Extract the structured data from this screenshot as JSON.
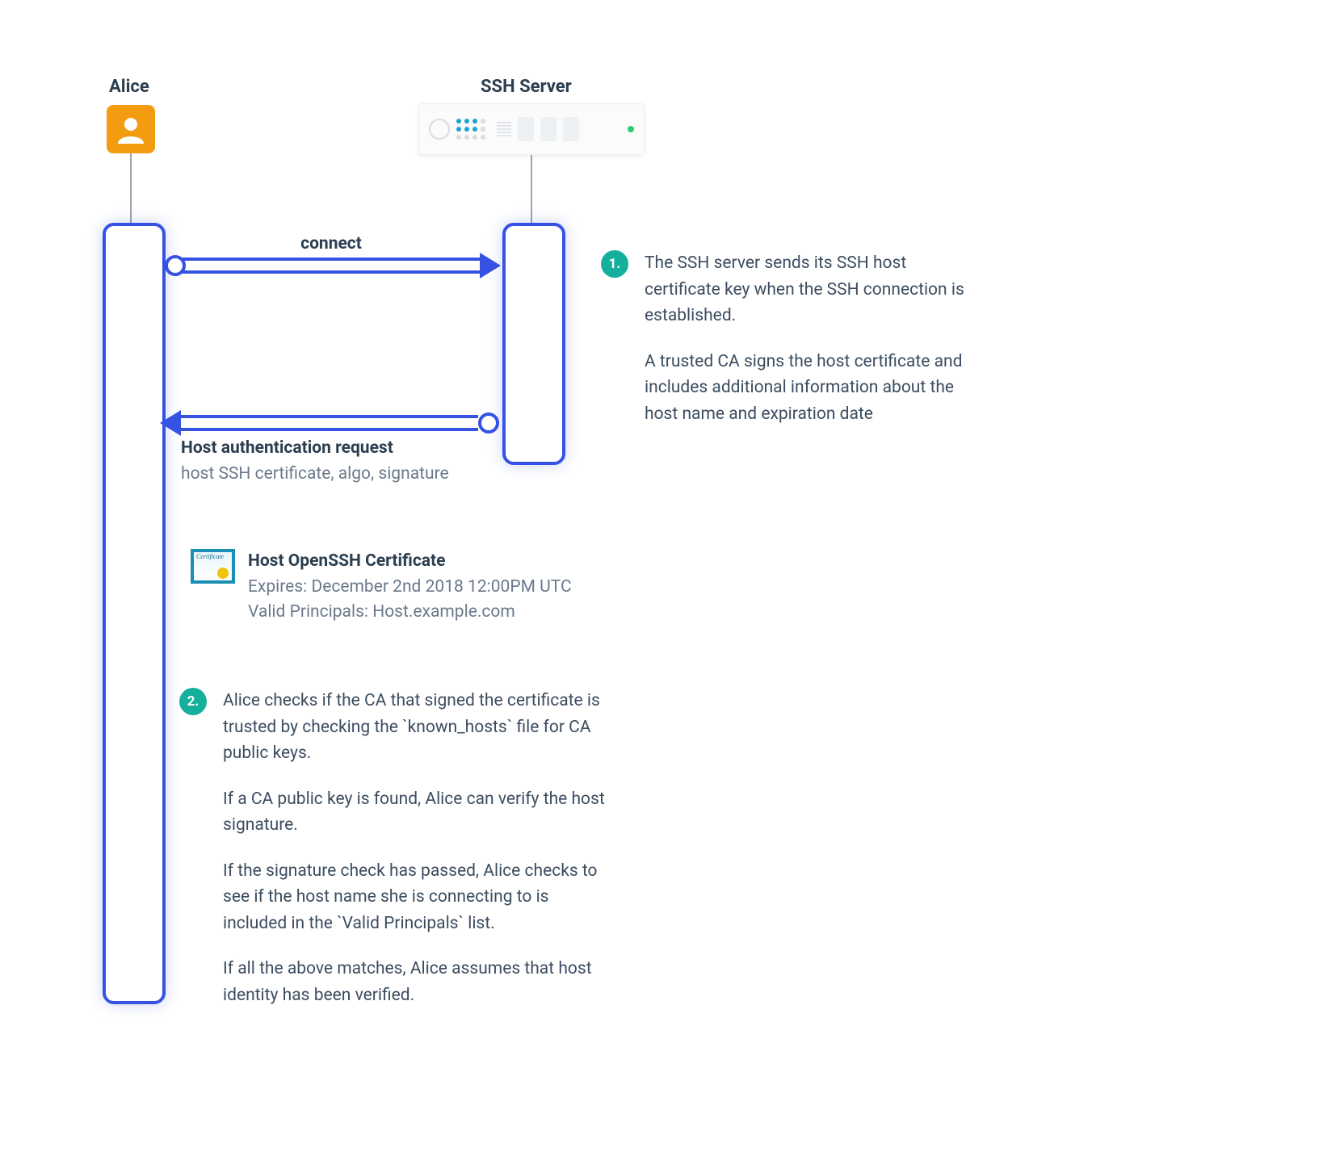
{
  "actors": {
    "alice": "Alice",
    "server": "SSH Server"
  },
  "arrows": {
    "connect": "connect",
    "host_auth_title": "Host authentication request",
    "host_auth_sub": "host SSH certificate, algo, signature"
  },
  "certificate": {
    "title": "Host OpenSSH Certificate",
    "expires": "Expires: December 2nd 2018 12:00PM UTC",
    "principals": "Valid Principals: Host.example.com",
    "badge_text": "Certificate"
  },
  "steps": {
    "one": {
      "num": "1.",
      "p1": "The SSH server sends its SSH host certificate key when the SSH connection is established.",
      "p2": "A trusted CA signs the host certificate and includes additional information about the host name and expiration date"
    },
    "two": {
      "num": "2.",
      "p1": "Alice checks if the CA that signed the certificate is trusted by checking the `known_hosts` file for CA public keys.",
      "p2": "If a CA public key is found, Alice can verify the host signature.",
      "p3": "If the signature check has passed, Alice checks to see if the host name she is connecting to is included in the `Valid Principals` list.",
      "p4": "If all the above matches, Alice assumes that host identity has been verified."
    }
  }
}
